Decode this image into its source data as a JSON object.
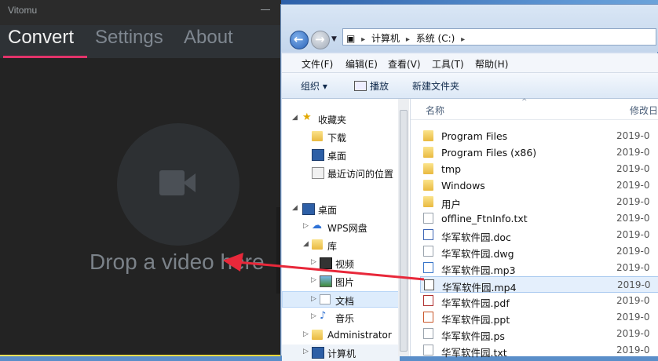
{
  "vitomu": {
    "title": "Vitomu",
    "tabs": [
      "Convert",
      "Settings",
      "About"
    ],
    "drop_text": "Drop a video here"
  },
  "explorer": {
    "breadcrumbs": [
      "计算机",
      "系统 (C:)"
    ],
    "menu": [
      "文件(F)",
      "编辑(E)",
      "查看(V)",
      "工具(T)",
      "帮助(H)"
    ],
    "toolbar": {
      "organize": "组织 ▾",
      "play": "播放",
      "new_folder": "新建文件夹"
    },
    "nav": {
      "favorites": "收藏夹",
      "downloads": "下载",
      "desktop": "桌面",
      "recent": "最近访问的位置",
      "desktop_root": "桌面",
      "wps": "WPS网盘",
      "library": "库",
      "videos": "视频",
      "pictures": "图片",
      "documents": "文档",
      "music": "音乐",
      "admin": "Administrator",
      "computer": "计算机"
    },
    "columns": {
      "name": "名称",
      "modified": "修改日"
    },
    "files": [
      {
        "name": "Program Files",
        "date": "2019-0",
        "kind": "folder"
      },
      {
        "name": "Program Files (x86)",
        "date": "2019-0",
        "kind": "folder"
      },
      {
        "name": "tmp",
        "date": "2019-0",
        "kind": "folder"
      },
      {
        "name": "Windows",
        "date": "2019-0",
        "kind": "folder"
      },
      {
        "name": "用户",
        "date": "2019-0",
        "kind": "folder"
      },
      {
        "name": "offline_FtnInfo.txt",
        "date": "2019-0",
        "kind": "file"
      },
      {
        "name": "华军软件园.doc",
        "date": "2019-0",
        "kind": "file-doc"
      },
      {
        "name": "华军软件园.dwg",
        "date": "2019-0",
        "kind": "file"
      },
      {
        "name": "华军软件园.mp3",
        "date": "2019-0",
        "kind": "file-mp3"
      },
      {
        "name": "华军软件园.mp4",
        "date": "2019-0",
        "kind": "file-mp4"
      },
      {
        "name": "华军软件园.pdf",
        "date": "2019-0",
        "kind": "file-pdf"
      },
      {
        "name": "华军软件园.ppt",
        "date": "2019-0",
        "kind": "file-ppt"
      },
      {
        "name": "华军软件园.ps",
        "date": "2019-0",
        "kind": "file"
      },
      {
        "name": "华军软件园.txt",
        "date": "2019-0",
        "kind": "file"
      }
    ],
    "selected_file_index": 9
  },
  "colors": {
    "accent": "#e2336a",
    "vitomu_bg": "#232323",
    "selection": "#e4effc"
  }
}
